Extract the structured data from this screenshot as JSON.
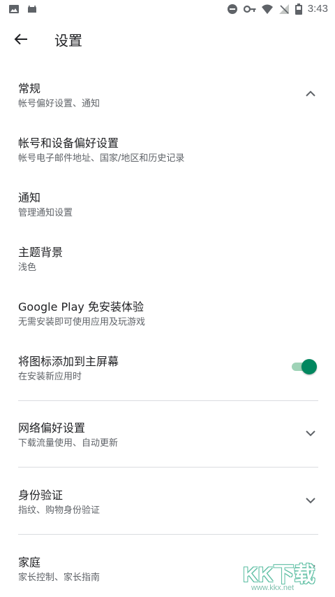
{
  "status_bar": {
    "time": "3:43",
    "left_icons": [
      "image-icon",
      "android-icon"
    ],
    "right_icons": [
      "dnd-icon",
      "key-icon",
      "wifi-icon",
      "no-signal-icon",
      "battery-icon"
    ]
  },
  "header": {
    "title": "设置"
  },
  "settings": {
    "general": {
      "title": "常规",
      "subtitle": "帐号偏好设置、通知",
      "state": "expanded"
    },
    "account": {
      "title": "帐号和设备偏好设置",
      "subtitle": "帐号电子邮件地址、国家/地区和历史记录"
    },
    "notifications": {
      "title": "通知",
      "subtitle": "管理通知设置"
    },
    "theme": {
      "title": "主题背景",
      "subtitle": "浅色"
    },
    "instant": {
      "title": "Google Play 免安装体验",
      "subtitle": "无需安装即可使用应用及玩游戏"
    },
    "home_icon": {
      "title": "将图标添加到主屏幕",
      "subtitle": "在安装新应用时",
      "enabled": true
    },
    "network": {
      "title": "网络偏好设置",
      "subtitle": "下载流量使用、自动更新",
      "state": "collapsed"
    },
    "auth": {
      "title": "身份验证",
      "subtitle": "指纹、购物身份验证",
      "state": "collapsed"
    },
    "family": {
      "title": "家庭",
      "subtitle": "家长控制、家长指南",
      "state": "collapsed"
    }
  },
  "watermark": {
    "text": "KK下载",
    "url": "www.kkx.net"
  },
  "colors": {
    "accent": "#01875f",
    "track": "#9fd3b7",
    "text_primary": "#202124",
    "text_secondary": "#5f6368",
    "divider": "#dadce0"
  }
}
